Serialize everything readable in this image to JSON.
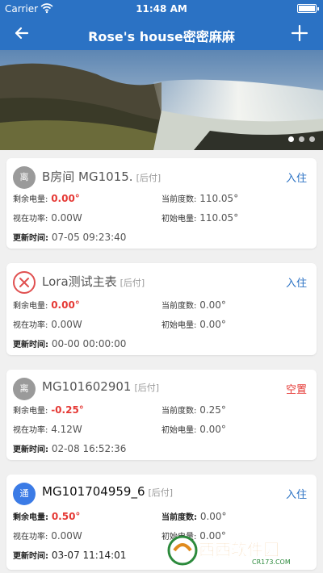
{
  "status": {
    "carrier": "Carrier",
    "time": "11:48 AM"
  },
  "header": {
    "title": "Rose's house密密麻麻"
  },
  "labels": {
    "remain": "剩余电量:",
    "current": "当前度数:",
    "power": "视在功率:",
    "initial": "初始电量:",
    "update": "更新时间:"
  },
  "cards": [
    {
      "badge": "离",
      "name": "B房间 MG1015.",
      "tag": "[后付]",
      "action": "入住",
      "remain": "0.00°",
      "current": "110.05°",
      "power": "0.00W",
      "initial": "110.05°",
      "update": "07-05 09:23:40"
    },
    {
      "badge": "",
      "name": "Lora测试主表",
      "tag": "[后付]",
      "action": "入住",
      "remain": "0.00°",
      "current": "0.00°",
      "power": "0.00W",
      "initial": "0.00°",
      "update": "00-00 00:00:00"
    },
    {
      "badge": "离",
      "name": "MG101602901",
      "tag": "[后付]",
      "action": "空置",
      "remain": "-0.25°",
      "current": "0.25°",
      "power": "4.12W",
      "initial": "0.00°",
      "update": "02-08 16:52:36"
    },
    {
      "badge": "通",
      "name": "MG101704959_6",
      "tag": "[后付]",
      "action": "入住",
      "remain": "0.50°",
      "current": "0.00°",
      "power": "0.00W",
      "initial": "0.00°",
      "update": "03-07 11:14:01"
    }
  ],
  "watermark": {
    "text": "西西软件园",
    "url": "CR173.COM"
  },
  "colors": {
    "brand": "#2b72c4",
    "alert": "#e53935",
    "badge_gray": "#9a9a9a",
    "badge_blue": "#3b7be6"
  },
  "icons": {
    "back": "arrow-left-icon",
    "add": "plus-icon",
    "error": "x-circle-icon",
    "wifi": "wifi-icon",
    "battery": "battery-icon"
  }
}
